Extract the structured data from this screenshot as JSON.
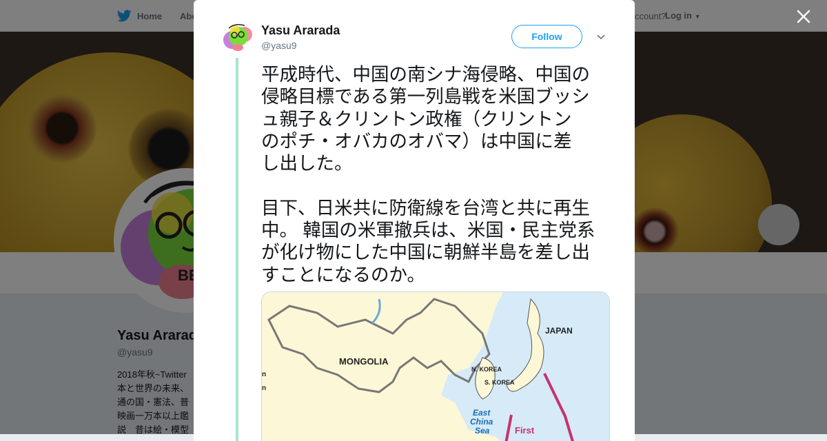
{
  "nav": {
    "home_label": "Home",
    "about_label": "Abo",
    "account_prompt": "ccount?",
    "login_label": "Log in"
  },
  "profile": {
    "name": "Yasu Ararada",
    "handle": "@yasu9",
    "avatar_text": "BE",
    "bio_lines": [
      "2018年秋~Twitter",
      "本と世界の未来、",
      "通の国・憲法、普",
      "映画一万本以上鑑",
      "説　昔は絵・模型"
    ]
  },
  "tweet": {
    "author_name": "Yasu Ararada",
    "author_handle": "@yasu9",
    "follow_label": "Follow",
    "text": "平成時代、中国の南シナ海侵略、中国の\n侵略目標である第一列島戦を米国ブッシ\nュ親子＆クリントン政権（クリントン\nのポチ・オバカのオバマ）は中国に差\nし出した。\n\n目下、日米共に防衛線を台湾と共に再生\n中。 韓国の米軍撤兵は、米国・民主党系\nが化け物にした中国に朝鮮半島を差し出\nすことになるのか。",
    "map": {
      "labels": {
        "mongolia": "MONGOLIA",
        "japan": "JAPAN",
        "n_korea": "N. KOREA",
        "s_korea": "S. KOREA",
        "east": "East",
        "china": "China",
        "sea": "Sea",
        "first": "First",
        "edge_n1": "n",
        "edge_n2": "n"
      }
    }
  },
  "icons": {
    "bird": "twitter-bird-icon",
    "close": "close-icon",
    "chevron": "chevron-down-icon"
  },
  "colors": {
    "brand": "#1da1f2",
    "thread": "#a6e6c8",
    "chain_line": "#c8316e"
  }
}
